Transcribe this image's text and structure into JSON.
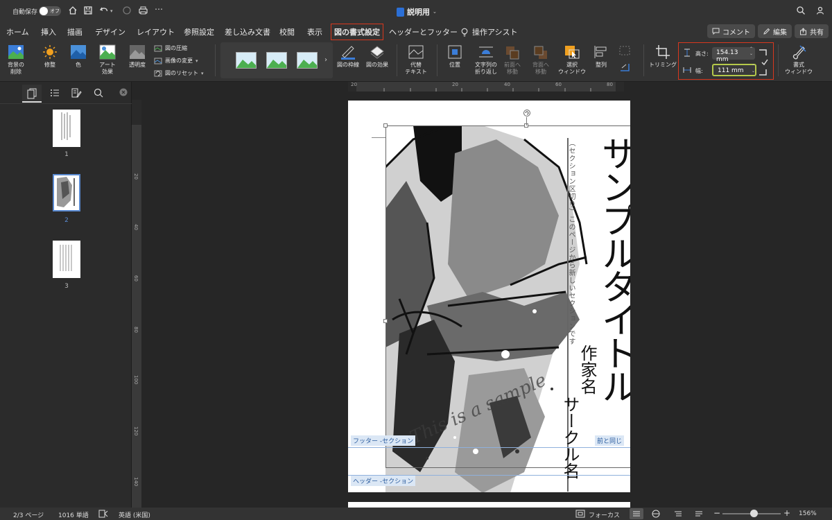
{
  "titlebar": {
    "autosave_label": "自動保存",
    "autosave_state": "オフ",
    "doc_title": "説明用"
  },
  "tabs": [
    {
      "label": "ホーム"
    },
    {
      "label": "挿入"
    },
    {
      "label": "描画"
    },
    {
      "label": "デザイン"
    },
    {
      "label": "レイアウト"
    },
    {
      "label": "参照設定"
    },
    {
      "label": "差し込み文書"
    },
    {
      "label": "校閲"
    },
    {
      "label": "表示"
    },
    {
      "label": "図の書式設定"
    },
    {
      "label": "ヘッダーとフッター"
    },
    {
      "label": "操作アシスト"
    }
  ],
  "tab_buttons": {
    "comment": "コメント",
    "edit": "編集",
    "share": "共有"
  },
  "ribbon": {
    "remove_bg": [
      "背景の",
      "削除"
    ],
    "corrections": "修整",
    "color": "色",
    "artistic": [
      "アート",
      "効果"
    ],
    "transparency": "透明度",
    "compress": "図の圧縮",
    "change_picture": "画像の変更",
    "reset_picture": "図のリセット",
    "border": "図の枠線",
    "effects": "図の効果",
    "alt_text": [
      "代替",
      "テキスト"
    ],
    "position": "位置",
    "wrap": [
      "文字列の",
      "折り返し"
    ],
    "forward": [
      "前面へ",
      "移動"
    ],
    "backward": [
      "背面へ",
      "移動"
    ],
    "selection_pane": [
      "選択",
      "ウィンドウ"
    ],
    "align": "整列",
    "crop": "トリミング",
    "height_label": "高さ:",
    "height_value": "154.13 mm",
    "width_label": "幅:",
    "width_value": "111 mm",
    "format_pane": [
      "書式",
      "ウィンドウ"
    ]
  },
  "ruler": {
    "h_ticks": [
      "20",
      "20",
      "40",
      "60",
      "80"
    ],
    "v_ticks": [
      "20",
      "40",
      "60",
      "80",
      "100",
      "120",
      "140"
    ]
  },
  "pages": [
    "1",
    "2",
    "3"
  ],
  "document": {
    "big_title": "サンプルタイトル",
    "small_note": "（セクション区切り）このページから新しいセクションです",
    "author": "作家名",
    "circle": "サークル名",
    "watermark": "This is a sample",
    "footer_section": "フッター -セクション",
    "same_as_prev": "前と同じ",
    "header_section": "ヘッダー -セクション"
  },
  "status": {
    "page": "2/3 ページ",
    "words": "1016 単語",
    "lang": "英語 (米国)",
    "focus": "フォーカス",
    "zoom": "156%"
  },
  "colors": {
    "accent_red": "#d9381e",
    "highlight_yellow": "#b5c94a"
  }
}
